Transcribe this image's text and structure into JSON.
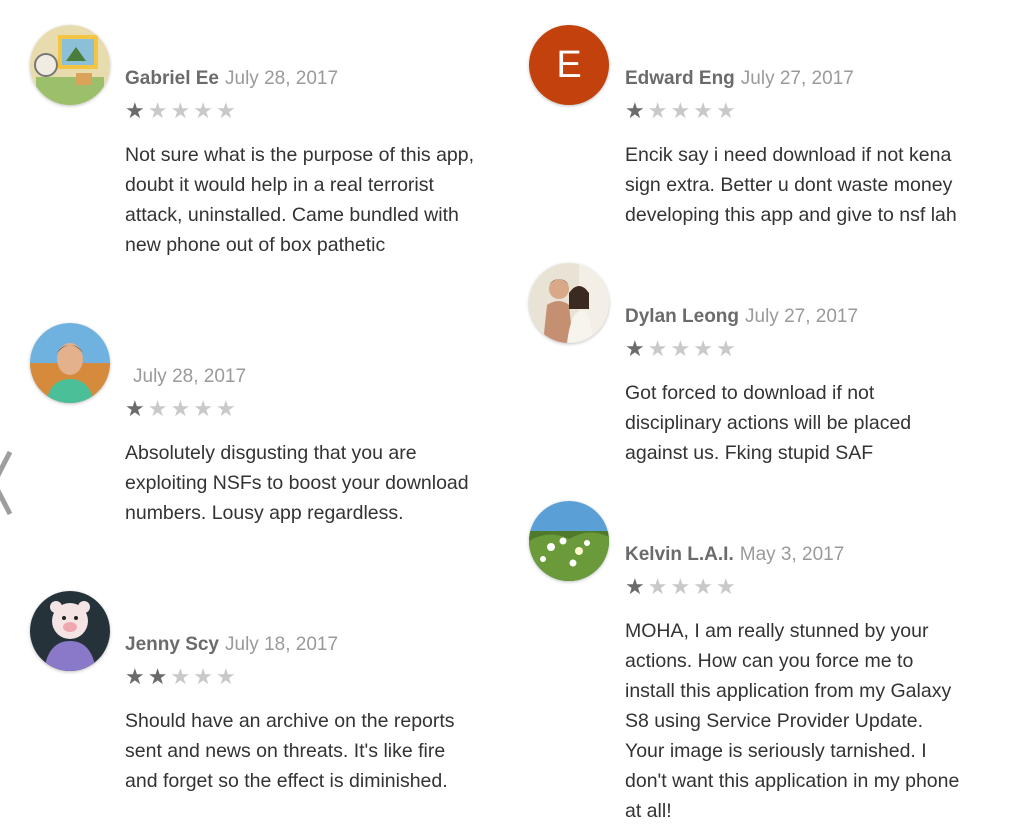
{
  "colors": {
    "star_filled": "#6b6b6b",
    "star_empty": "#c9c9c9",
    "letter_avatar_bg": "#c2410c",
    "author": "#6b6b6b",
    "date": "#9a9a9a",
    "body": "#333333"
  },
  "reviews": [
    {
      "author": "Gabriel Ee",
      "date": "July 28, 2017",
      "rating": 1,
      "avatar_icon": "painting-avatar-icon",
      "text": "Not sure what is the purpose of this app, doubt it would help in a real terrorist attack, uninstalled. Came bundled with new phone out of box pathetic"
    },
    {
      "author": "",
      "date": "July 28, 2017",
      "rating": 1,
      "avatar_icon": "person-desert-avatar-icon",
      "text": "Absolutely disgusting that you are exploiting NSFs to boost your download numbers. Lousy app regardless."
    },
    {
      "author": "Jenny Scy",
      "date": "July 18, 2017",
      "rating": 2,
      "avatar_icon": "plush-toy-avatar-icon",
      "text": "Should have an archive on the reports sent and news on threats. It's like fire and forget so the effect is diminished."
    },
    {
      "author": "Edward Eng",
      "date": "July 27, 2017",
      "rating": 1,
      "avatar_letter": "E",
      "text": "Encik say i need download if not kena sign extra. Better u dont waste money developing this app and give to nsf lah"
    },
    {
      "author": "Dylan Leong",
      "date": "July 27, 2017",
      "rating": 1,
      "avatar_icon": "couple-photo-avatar-icon",
      "text": "Got forced to download if not disciplinary actions will be placed against us. Fking stupid SAF"
    },
    {
      "author": "Kelvin L.A.I.",
      "date": "May 3, 2017",
      "rating": 1,
      "avatar_icon": "flowers-avatar-icon",
      "text": "MOHA, I am really stunned by your actions. How can you force me to install this application from my Galaxy S8 using Service Provider Update. Your image is seriously tarnished. I don't want this application in my phone at all!"
    }
  ]
}
